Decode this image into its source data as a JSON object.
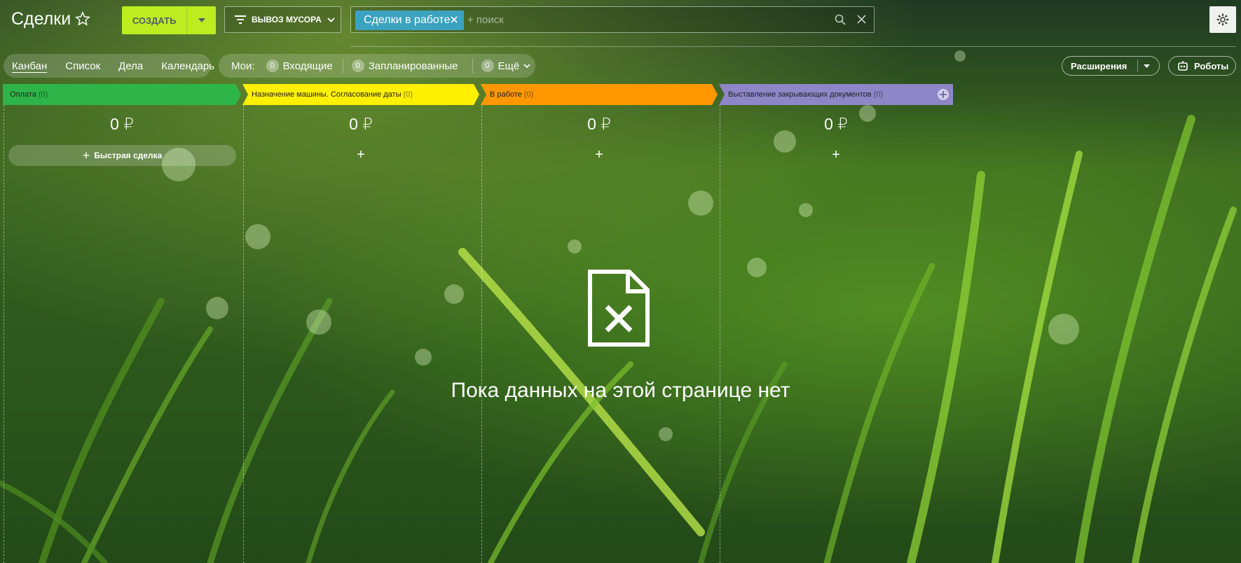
{
  "header": {
    "title": "Сделки",
    "create_label": "СОЗДАТЬ",
    "filter_label": "ВЫВОЗ МУСОРА",
    "search_chip": "Сделки в работе",
    "search_placeholder": "+ поиск"
  },
  "views": [
    "Канбан",
    "Список",
    "Дела",
    "Календарь"
  ],
  "counters": {
    "mine_label": "Мои:",
    "items": [
      {
        "count": "0",
        "label": "Входящие"
      },
      {
        "count": "0",
        "label": "Запланированные"
      },
      {
        "count": "0",
        "label": "Ещё"
      }
    ]
  },
  "toolbar": {
    "extensions_label": "Расширения",
    "robots_label": "Роботы"
  },
  "stages": [
    {
      "name": "Оплата",
      "count": "(0)",
      "sum": "0 ₽",
      "color": "#2eb549",
      "text_color": "#222222"
    },
    {
      "name": "Назначение машины. Согласование даты",
      "count": "(0)",
      "sum": "0 ₽",
      "color": "#ffef00",
      "text_color": "#222222"
    },
    {
      "name": "В работе",
      "count": "(0)",
      "sum": "0 ₽",
      "color": "#ff9800",
      "text_color": "#222222"
    },
    {
      "name": "Выставление закрывающих документов",
      "count": "(0)",
      "sum": "0 ₽",
      "color": "#8f86c8",
      "text_color": "#222222"
    }
  ],
  "quick_deal_label": "Быстрая сделка",
  "empty_state": {
    "text": "Пока данных на этой странице нет",
    "icon": "file-delete-icon"
  },
  "colors": {
    "accent": "#bbed21",
    "chip": "#3ba3c0"
  }
}
